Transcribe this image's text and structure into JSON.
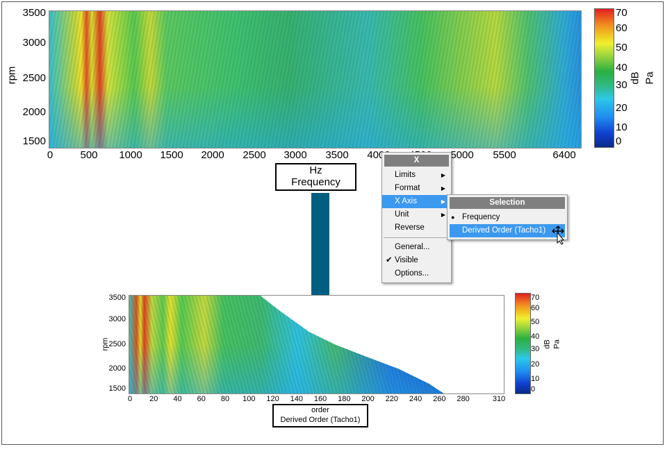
{
  "top_chart": {
    "y_ticks": [
      "3500",
      "3000",
      "2500",
      "2000",
      "1500"
    ],
    "x_ticks": [
      "0",
      "500",
      "1000",
      "1500",
      "2000",
      "2500",
      "3000",
      "3500",
      "4000",
      "4500",
      "5000",
      "5500",
      "6400"
    ],
    "ylabel": "rpm",
    "xlabel_unit": "Hz",
    "xlabel": "Frequency",
    "colorbar_ticks": [
      "70",
      "60",
      "50",
      "40",
      "30",
      "20",
      "10",
      "0"
    ],
    "colorbar_unit": "dB",
    "colorbar_ref": "Pa"
  },
  "context_menu": {
    "title": "X",
    "items": [
      {
        "label": "Limits",
        "submenu": true
      },
      {
        "label": "Format",
        "submenu": true
      },
      {
        "label": "X Axis",
        "submenu": true,
        "highlighted": true
      },
      {
        "label": "Unit",
        "submenu": true
      },
      {
        "label": "Reverse"
      }
    ],
    "items2": [
      {
        "label": "General..."
      },
      {
        "label": "Visible",
        "checked": true
      },
      {
        "label": "Options..."
      }
    ],
    "submenu": {
      "title": "Selection",
      "items": [
        {
          "label": "Frequency",
          "selected": true
        },
        {
          "label": "Derived Order (Tacho1)",
          "highlighted": true
        }
      ]
    }
  },
  "bottom_chart": {
    "y_ticks": [
      "3500",
      "3000",
      "2500",
      "2000",
      "1500"
    ],
    "x_ticks": [
      "0",
      "20",
      "40",
      "60",
      "80",
      "100",
      "120",
      "140",
      "160",
      "180",
      "200",
      "220",
      "240",
      "260",
      "280",
      "310"
    ],
    "ylabel": "rpm",
    "xlabel_unit": "order",
    "xlabel": "Derived Order (Tacho1)",
    "colorbar_ticks": [
      "70",
      "60",
      "50",
      "40",
      "30",
      "20",
      "10",
      "0"
    ],
    "colorbar_unit": "dB",
    "colorbar_ref": "Pa"
  },
  "colors": {
    "arrow": "#005f80",
    "menu_highlight": "#3c99f0",
    "menu_header": "#7f7f7f"
  }
}
